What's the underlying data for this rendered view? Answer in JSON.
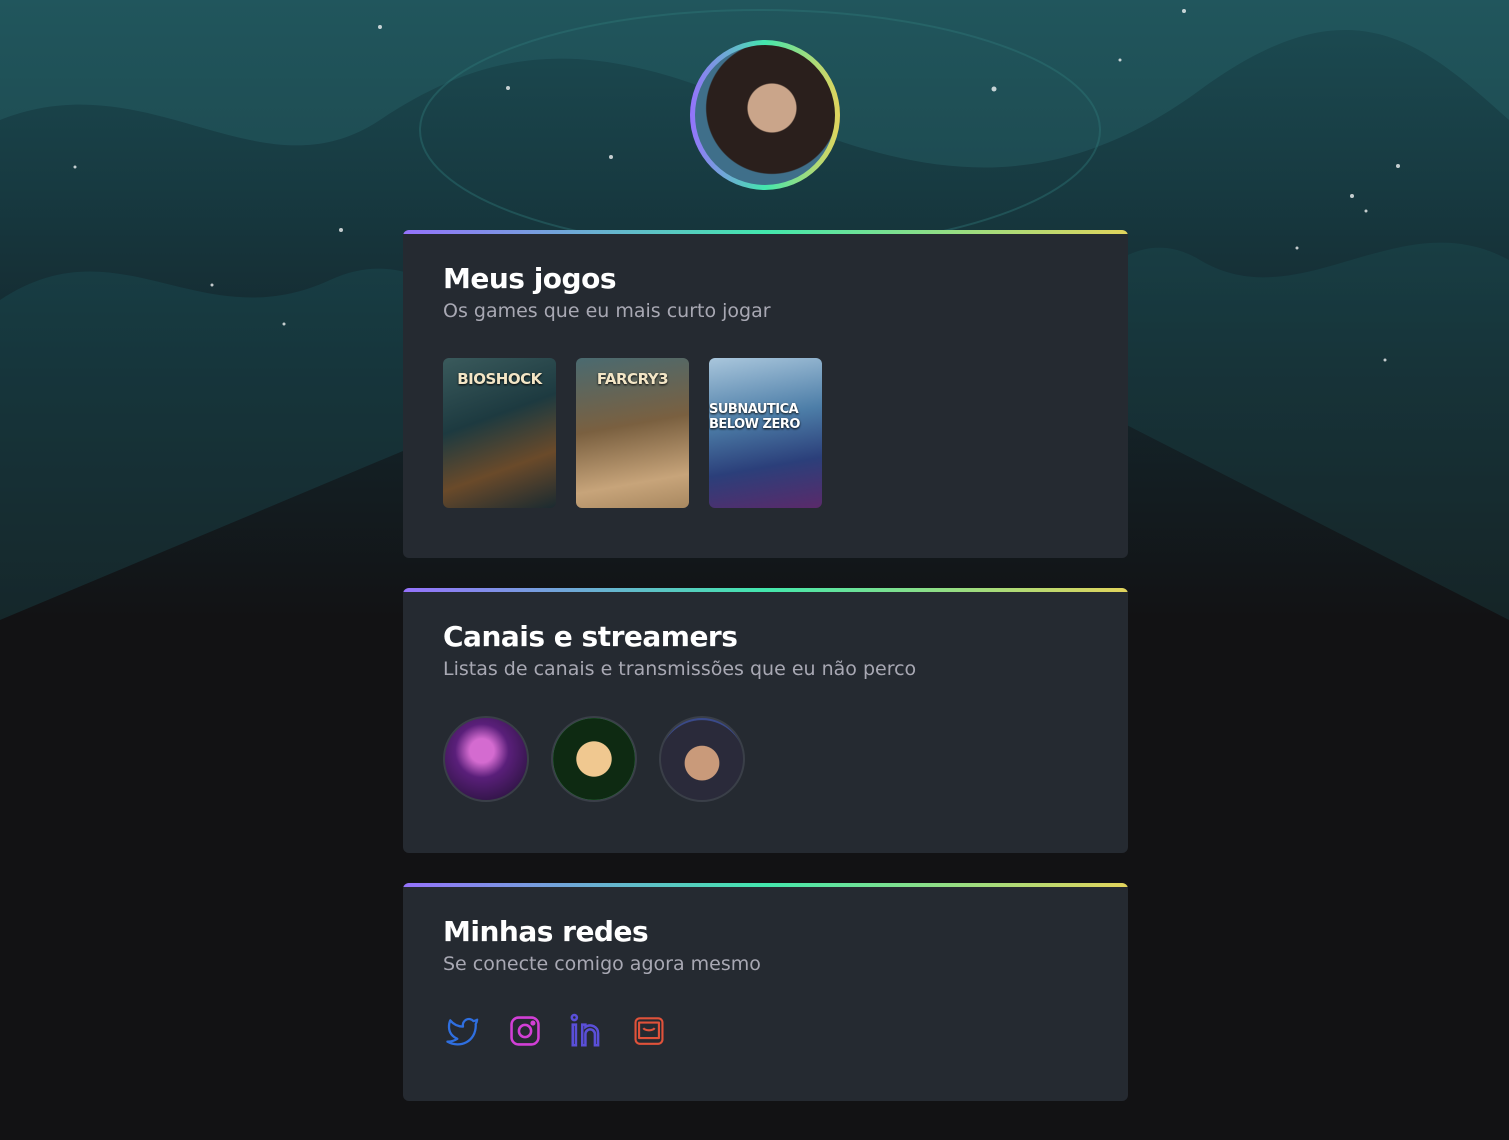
{
  "profile": {
    "avatar_icon": "profile-photo"
  },
  "games_section": {
    "title": "Meus jogos",
    "subtitle": "Os games que eu mais curto jogar",
    "games": [
      {
        "label": "BIOSHOCK"
      },
      {
        "label": "FARCRY3"
      },
      {
        "label": "SUBNAUTICA BELOW ZERO"
      }
    ]
  },
  "streamers_section": {
    "title": "Canais e streamers",
    "subtitle": "Listas de canais e transmissões que eu não perco",
    "streamers": [
      "streamer-1",
      "casimiro",
      "streamer-3"
    ]
  },
  "social_section": {
    "title": "Minhas redes",
    "subtitle": "Se conecte comigo agora mesmo",
    "links": [
      {
        "icon": "twitter-icon",
        "color": "#2f6fe0"
      },
      {
        "icon": "instagram-icon",
        "color": "#d23fd6"
      },
      {
        "icon": "linkedin-icon",
        "color": "#5a4fd8"
      },
      {
        "icon": "mail-icon",
        "color": "#e0523a"
      }
    ]
  },
  "colors": {
    "gradient_start": "#9572fc",
    "gradient_mid": "#43e7ad",
    "gradient_end": "#e2d45c",
    "card_bg": "#252a31",
    "page_bg": "#121214"
  }
}
